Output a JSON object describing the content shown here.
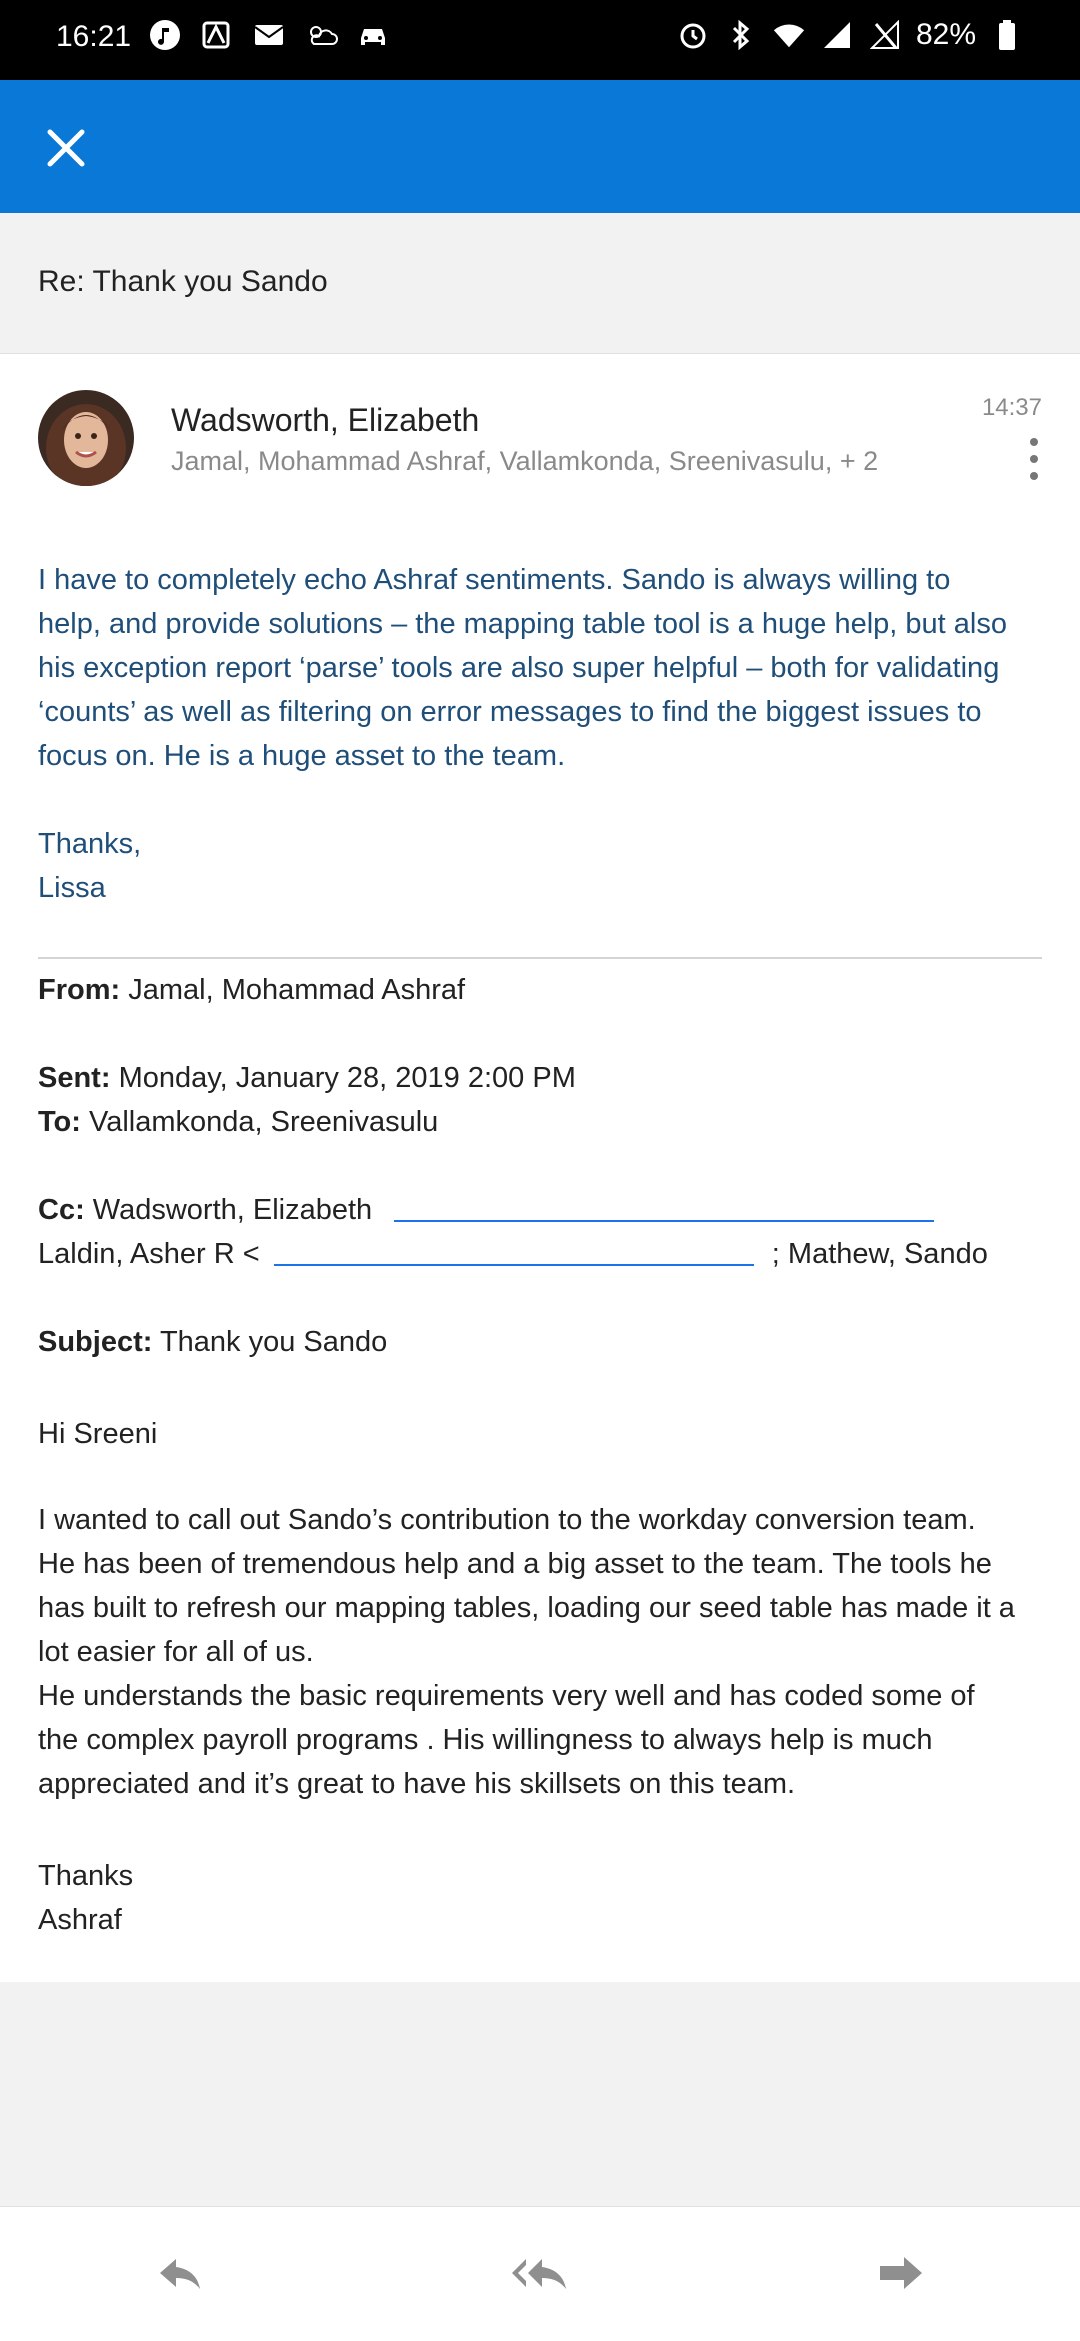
{
  "status_bar": {
    "time": "16:21",
    "battery": "82%",
    "left_icons": [
      "music-icon",
      "app-icon",
      "mail-icon",
      "weather-icon",
      "car-icon"
    ],
    "right_icons": [
      "alarm-icon",
      "bluetooth-icon",
      "wifi-icon",
      "signal-icon",
      "signal-off-icon",
      "battery-icon"
    ]
  },
  "app_bar": {
    "close_icon": "close-icon",
    "color": "#0a78d7"
  },
  "subject": "Re: Thank you Sando",
  "message": {
    "sender": "Wadsworth, Elizabeth",
    "recipients": "Jamal, Mohammad Ashraf, Vallamkonda, Sreenivasulu, + 2",
    "time": "14:37",
    "body_lines": [
      "I have to completely echo Ashraf sentiments. Sando is always willing to",
      "help, and provide solutions – the mapping table tool is a huge help, but also",
      "his exception report ‘parse’ tools are also super helpful – both for validating",
      "‘counts’ as well as filtering on error messages to find the biggest issues to",
      "focus on. He is a huge asset to the team."
    ],
    "signoff": [
      "Thanks,",
      "Lissa"
    ],
    "body_color": "#1f4e79"
  },
  "quoted": {
    "from_label": "From:",
    "from_value": "Jamal, Mohammad Ashraf",
    "sent_label": "Sent:",
    "sent_value": "Monday, January 28, 2019 2:00 PM",
    "to_label": "To:",
    "to_value": "Vallamkonda, Sreenivasulu",
    "cc_label": "Cc:",
    "cc_value_1": "Wadsworth, Elizabeth",
    "cc_line2_a": "Laldin, Asher R <",
    "cc_line2_b": "; Mathew, Sando",
    "subject_label": "Subject:",
    "subject_value": "Thank you Sando",
    "greeting": "Hi Sreeni",
    "para1": [
      "I wanted to call out Sando’s contribution to the workday conversion team.",
      "He has been of tremendous help and a big asset to the team. The tools he",
      "has built to refresh our mapping tables, loading our seed table has made it a",
      "lot easier for all of us.",
      "He understands the basic requirements very well and has coded some of",
      "the complex payroll programs . His willingness to always help is much",
      "appreciated and it’s great to have his skillsets on this team."
    ],
    "closing": [
      "Thanks",
      "Ashraf"
    ]
  },
  "toolbar": {
    "reply_icon": "reply-icon",
    "reply_all_icon": "reply-all-icon",
    "forward_icon": "forward-icon"
  }
}
